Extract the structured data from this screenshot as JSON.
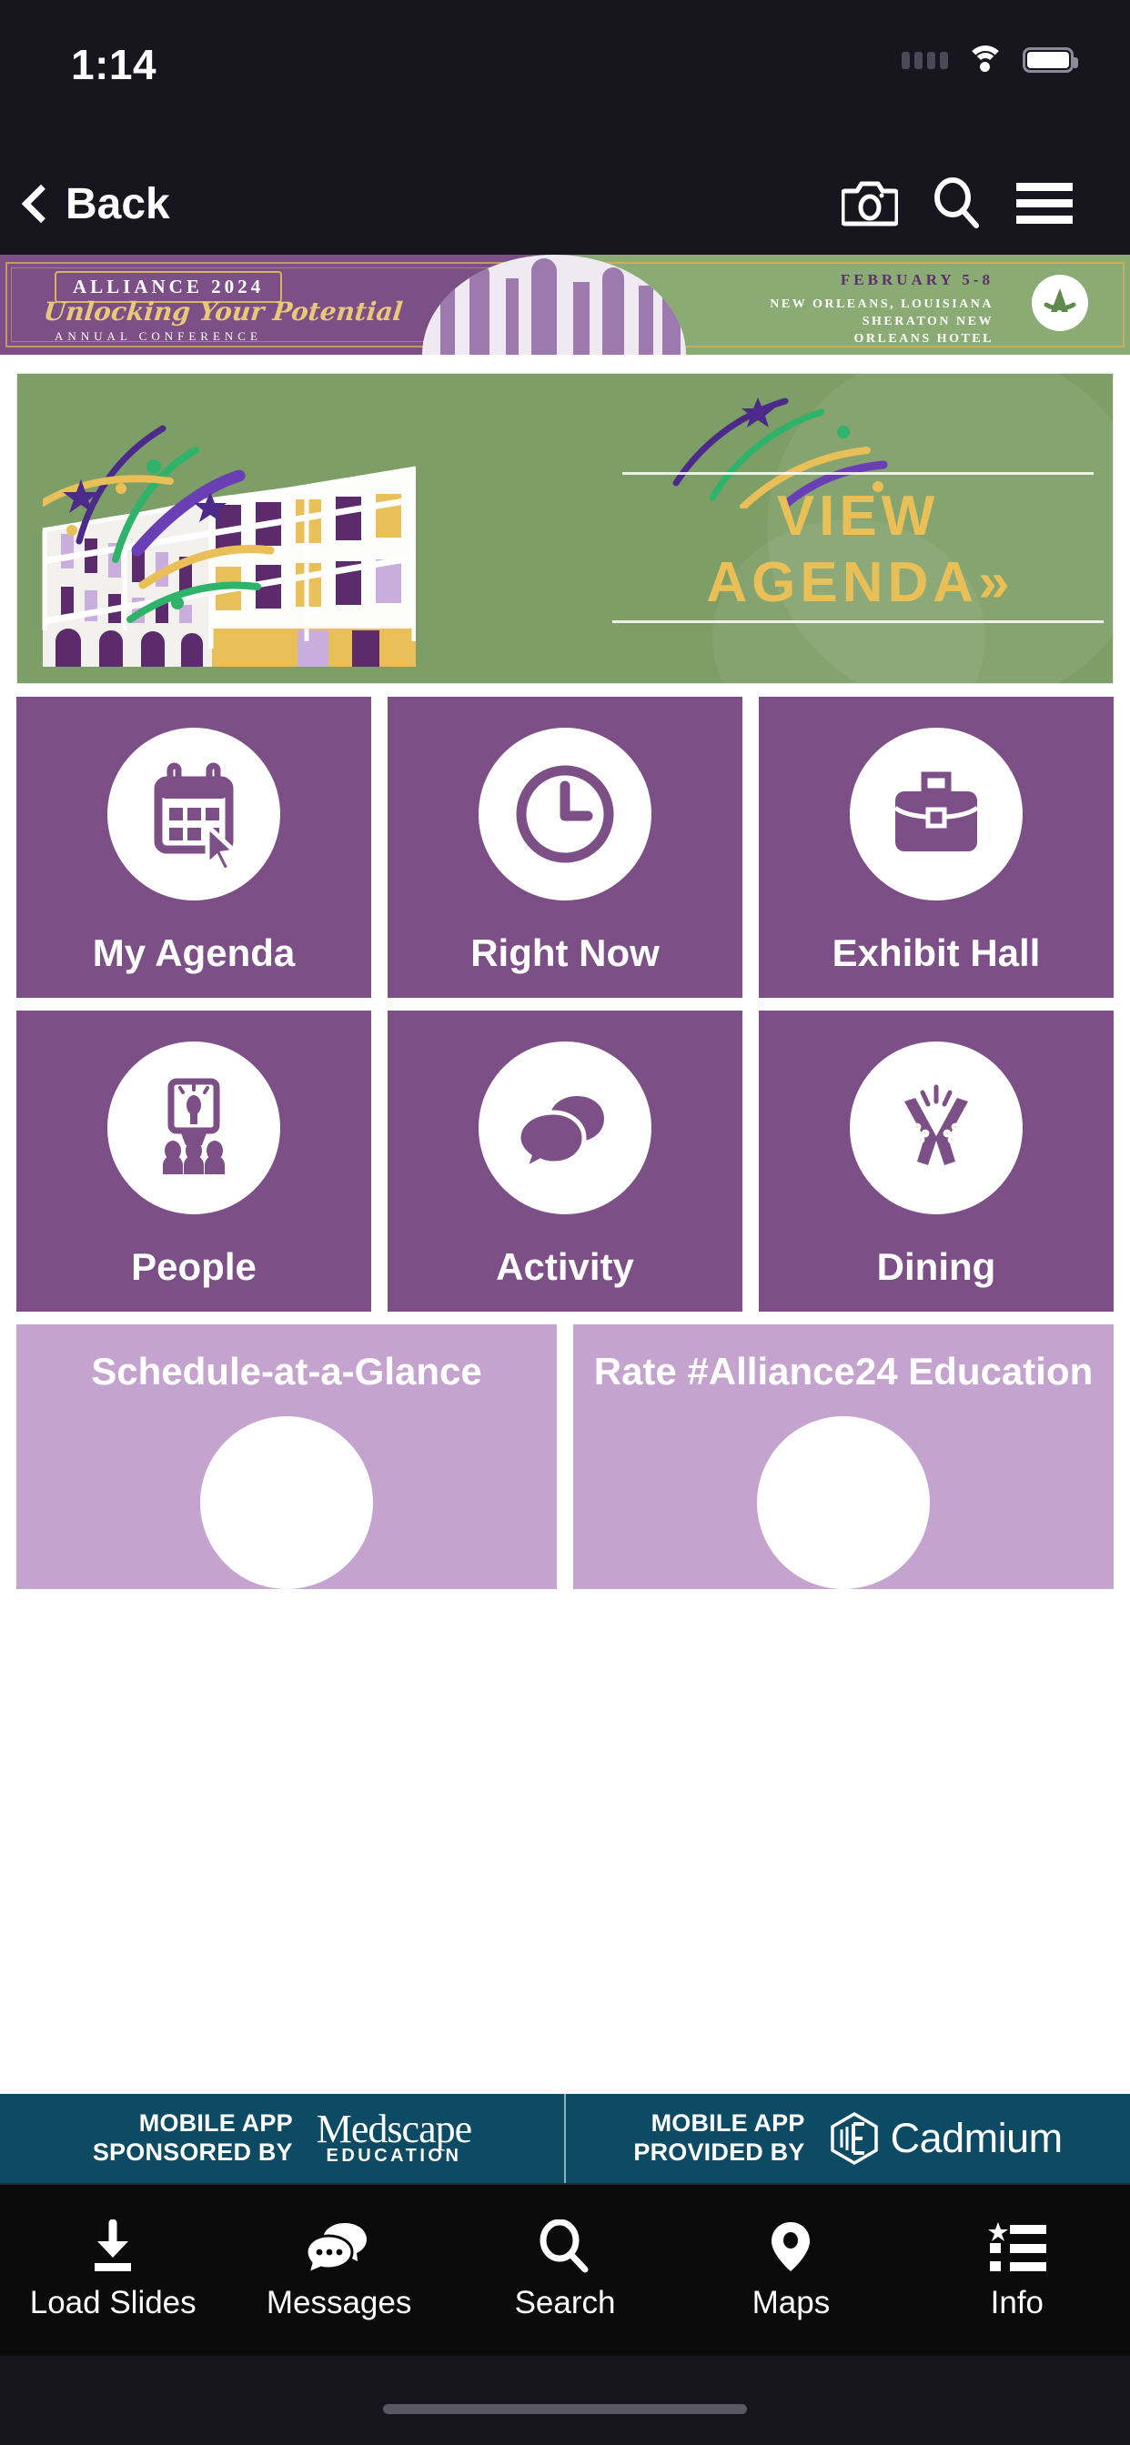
{
  "status": {
    "time": "1:14",
    "cellular_icon": "cellular-dots-icon",
    "wifi_icon": "wifi-icon",
    "battery_icon": "battery-full-icon"
  },
  "nav": {
    "back_label": "Back",
    "back_icon": "chevron-left-icon",
    "camera_icon": "camera-icon",
    "search_icon": "search-icon",
    "menu_icon": "hamburger-menu-icon"
  },
  "conference_banner": {
    "title": "ALLIANCE 2024",
    "script": "Unlocking Your Potential",
    "subtitle": "ANNUAL          CONFERENCE",
    "dates": "FEBRUARY 5-8",
    "location_line1": "NEW ORLEANS, LOUISIANA",
    "location_line2": "SHERATON NEW",
    "location_line3": "ORLEANS HOTEL",
    "logo_icon": "alliance-a-logo-icon",
    "purple": "#7c4f86",
    "green": "#8aab74",
    "gold": "#d9b35e"
  },
  "hero": {
    "line1": "VIEW",
    "line2": "AGENDA",
    "chevrons": "»",
    "building_icon": "new-orleans-building-illustration",
    "confetti_icon": "fireworks-confetti-icon",
    "bg_color": "#7d9e66",
    "text_color": "#e9bf58"
  },
  "tiles": [
    {
      "label": "My Agenda",
      "icon": "calendar-click-icon",
      "style": "dark"
    },
    {
      "label": "Right Now",
      "icon": "clock-icon",
      "style": "dark"
    },
    {
      "label": "Exhibit Hall",
      "icon": "briefcase-icon",
      "style": "dark"
    },
    {
      "label": "People",
      "icon": "presentation-audience-icon",
      "style": "dark"
    },
    {
      "label": "Activity",
      "icon": "speech-bubbles-icon",
      "style": "dark"
    },
    {
      "label": "Dining",
      "icon": "champagne-toast-icon",
      "style": "dark"
    }
  ],
  "light_tiles": [
    {
      "label": "Schedule-at-a-Glance",
      "icon": "schedule-icon",
      "style": "light"
    },
    {
      "label": "Rate #Alliance24 Education",
      "icon": "rate-icon",
      "style": "light"
    }
  ],
  "sponsor": {
    "left_text_line1": "MOBILE APP",
    "left_text_line2": "SPONSORED BY",
    "left_logo_name": "Medscape",
    "left_logo_sub": "EDUCATION",
    "left_logo_icon": "medscape-education-logo",
    "right_text_line1": "MOBILE APP",
    "right_text_line2": "PROVIDED BY",
    "right_logo_name": "Cadmium",
    "right_logo_icon": "cadmium-hexagon-logo",
    "bg_color": "#0d4a63"
  },
  "tabs": [
    {
      "label": "Load Slides",
      "icon": "download-icon"
    },
    {
      "label": "Messages",
      "icon": "chat-bubbles-icon"
    },
    {
      "label": "Search",
      "icon": "search-icon"
    },
    {
      "label": "Maps",
      "icon": "map-pin-icon"
    },
    {
      "label": "Info",
      "icon": "list-star-icon"
    }
  ]
}
